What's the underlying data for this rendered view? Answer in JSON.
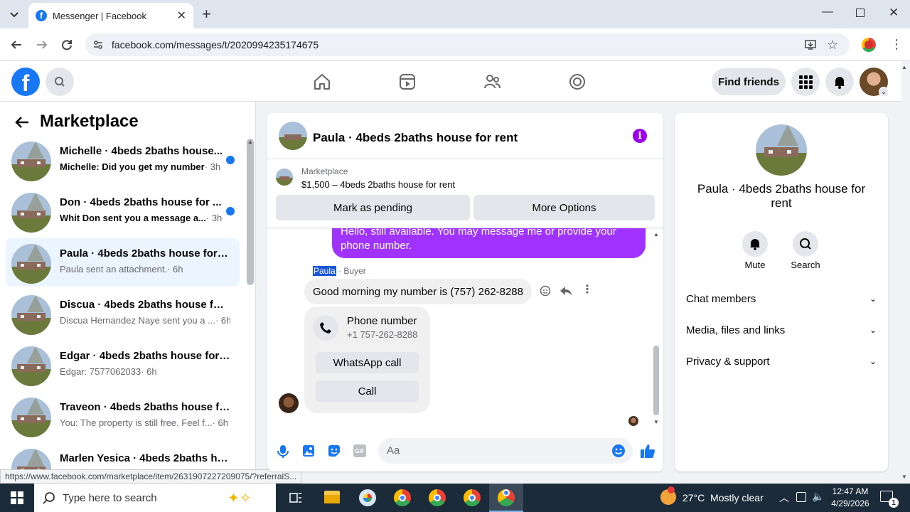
{
  "browser": {
    "tab_title": "Messenger | Facebook",
    "url": "facebook.com/messages/t/2020994235174675",
    "status_url": "https://www.facebook.com/marketplace/item/2631907227209075/?referralS..."
  },
  "nav": {
    "find_friends": "Find friends"
  },
  "left": {
    "title": "Marketplace",
    "conversations": [
      {
        "title": "Michelle · 4beds 2baths house...",
        "preview": "Michelle: Did you get my number",
        "time": "· 3h",
        "unread": true
      },
      {
        "title": "Don · 4beds 2baths house for ...",
        "preview": "Whit Don sent you a message a...",
        "time": "· 3h",
        "unread": true
      },
      {
        "title": "Paula · 4beds 2baths house for r...",
        "preview": "Paula sent an attachment.",
        "time": "· 6h",
        "unread": false,
        "active": true
      },
      {
        "title": "Discua · 4beds 2baths house for ...",
        "preview": "Discua Hernandez Naye sent you a ...",
        "time": "· 6h",
        "unread": false
      },
      {
        "title": "Edgar · 4beds 2baths house for r...",
        "preview": "Edgar: 7577062033",
        "time": "· 6h",
        "unread": false
      },
      {
        "title": "Traveon · 4beds 2baths house fo...",
        "preview": "You: The property is still free. Feel f...",
        "time": "· 6h",
        "unread": false
      },
      {
        "title": "Marlen Yesica · 4beds 2baths ho...",
        "preview": "",
        "time": "",
        "unread": false
      }
    ]
  },
  "chat": {
    "header_title": "Paula · 4beds 2baths house for rent",
    "listing_source": "Marketplace",
    "listing_line": "$1,500 – 4beds 2baths house for rent",
    "mark_pending": "Mark as pending",
    "more_options": "More Options",
    "my_message": "Hello, still available. You may message me or provide your phone number.",
    "sender_name": "Paula",
    "sender_role": " · Buyer",
    "their_message": "Good morning my number is (757) 262-8288",
    "phone_card_title": "Phone number",
    "phone_card_number": "+1 757-262-8288",
    "whatsapp_call": "WhatsApp call",
    "call": "Call",
    "composer_placeholder": "Aa"
  },
  "right": {
    "title": "Paula · 4beds 2baths house for rent",
    "mute": "Mute",
    "search": "Search",
    "sections": [
      "Chat members",
      "Media, files and links",
      "Privacy & support"
    ]
  },
  "taskbar": {
    "search_placeholder": "Type here to search",
    "weather": "27°C  Mostly clear",
    "time": "12:47 AM",
    "date": "4/29/2026",
    "notification_count": "1"
  },
  "colors": {
    "fb_blue": "#1877f2",
    "messenger_purple": "#a033ff",
    "info_purple": "#9b00e8"
  }
}
